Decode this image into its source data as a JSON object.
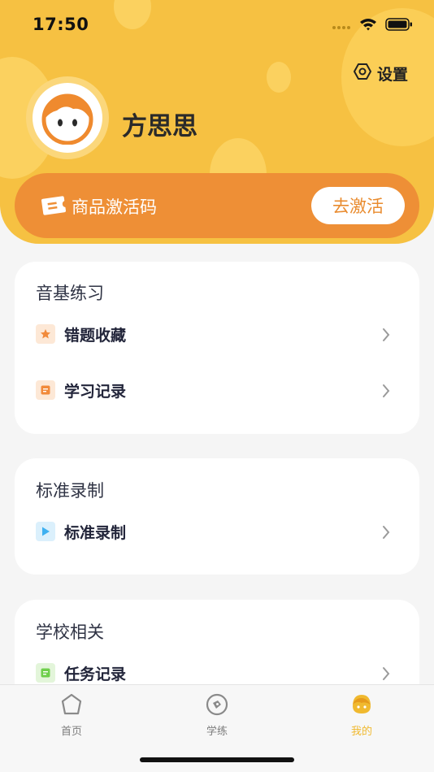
{
  "status_bar": {
    "time": "17:50"
  },
  "header": {
    "settings_label": "设置",
    "username": "方思思"
  },
  "activation": {
    "label": "商品激活码",
    "button_label": "去激活"
  },
  "sections": [
    {
      "title": "音基练习",
      "items": [
        {
          "label": "错题收藏",
          "icon": "star-icon",
          "color": "#f18a3b"
        },
        {
          "label": "学习记录",
          "icon": "record-icon",
          "color": "#f18a3b"
        }
      ]
    },
    {
      "title": "标准录制",
      "items": [
        {
          "label": "标准录制",
          "icon": "play-icon",
          "color": "#3eb0f0"
        }
      ]
    },
    {
      "title": "学校相关",
      "items": [
        {
          "label": "任务记录",
          "icon": "task-icon",
          "color": "#6fcf4c"
        }
      ]
    }
  ],
  "tab_bar": {
    "items": [
      {
        "label": "首页",
        "icon": "home-icon"
      },
      {
        "label": "学练",
        "icon": "practice-icon"
      },
      {
        "label": "我的",
        "icon": "profile-icon",
        "active": true
      }
    ]
  },
  "colors": {
    "brand_yellow": "#f6c142",
    "accent_orange": "#ee8f36",
    "active_tab": "#f0b92f"
  }
}
